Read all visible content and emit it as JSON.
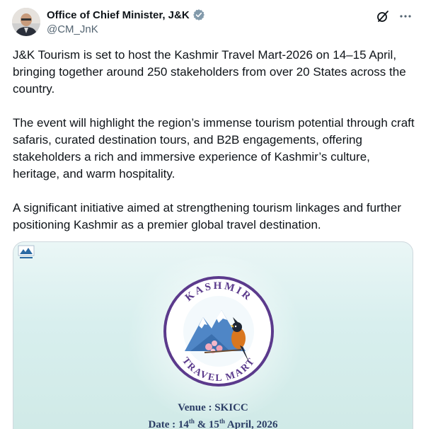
{
  "author": {
    "display_name": "Office of Chief Minister, J&K",
    "handle": "@CM_JnK"
  },
  "post": {
    "paragraphs": [
      "J&K Tourism is set to host the Kashmir Travel Mart-2026 on 14–15 April, bringing together around 250 stakeholders from over 20 States across the country.",
      "The event will highlight the region’s immense tourism potential through craft safaris, curated destination tours, and B2B engagements, offering stakeholders a rich and immersive experience of Kashmir’s culture, heritage, and warm hospitality.",
      "A significant initiative aimed at strengthening tourism linkages and further positioning Kashmir as a premier global travel destination."
    ]
  },
  "media": {
    "logo_top_text": "KASHMIR",
    "logo_bottom_text": "TRAVEL MART",
    "venue": "Venue : SKICC",
    "date_prefix": "Date : 14",
    "date_sup1": "th",
    "date_mid": " & 15",
    "date_sup2": "th",
    "date_suffix": " April, 2026"
  },
  "icons": {
    "verified": "verified-badge-icon",
    "grok": "grok-icon",
    "more": "more-icon"
  },
  "colors": {
    "text": "#0f1419",
    "secondary": "#536471",
    "verified_badge": "#829aab",
    "logo_purple": "#5b3a8c"
  }
}
